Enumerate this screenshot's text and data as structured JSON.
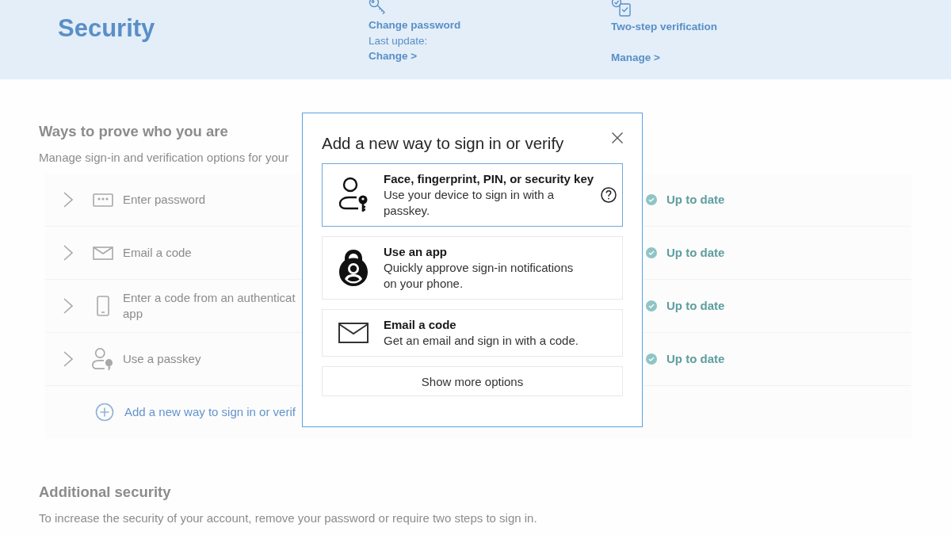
{
  "header": {
    "title": "Security",
    "cards": [
      {
        "kind": "password",
        "title": "Change password",
        "subtitle": "Last update:",
        "link": "Change >"
      },
      {
        "kind": "two-step",
        "title": "Two-step verification",
        "link": "Manage >"
      }
    ]
  },
  "methods": {
    "title": "Ways to prove who you are",
    "description": "Manage sign-in and verification options for your",
    "rows": [
      {
        "kind": "password",
        "label": "Enter password",
        "expanded": false,
        "status": "Up to date"
      },
      {
        "kind": "email",
        "label": "Email a code",
        "expanded": false,
        "status": "Up to date"
      },
      {
        "kind": "phone",
        "label": "Enter a code from an authenticat app",
        "expanded": false,
        "status": "Up to date"
      },
      {
        "kind": "passkey",
        "label": "Use a passkey",
        "expanded": false,
        "status": "Up to date"
      }
    ],
    "add_link": "Add a new way to sign in or verif"
  },
  "additional": {
    "title": "Additional security",
    "description": "To increase the security of your account, remove your password or require two steps to sign in."
  },
  "dialog": {
    "title": "Add a new way to sign in or verify",
    "options": [
      {
        "kind": "passkey",
        "title": "Face, fingerprint, PIN, or security key",
        "description": "Use your device to sign in with a passkey.",
        "selected": true,
        "help": true
      },
      {
        "kind": "app",
        "title": "Use an app",
        "description": "Quickly approve sign-in notifications on your phone.",
        "selected": false,
        "help": false
      },
      {
        "kind": "email",
        "title": "Email a code",
        "description": "Get an email and sign in with a code.",
        "selected": false,
        "help": false
      }
    ],
    "more_button": "Show more options"
  }
}
